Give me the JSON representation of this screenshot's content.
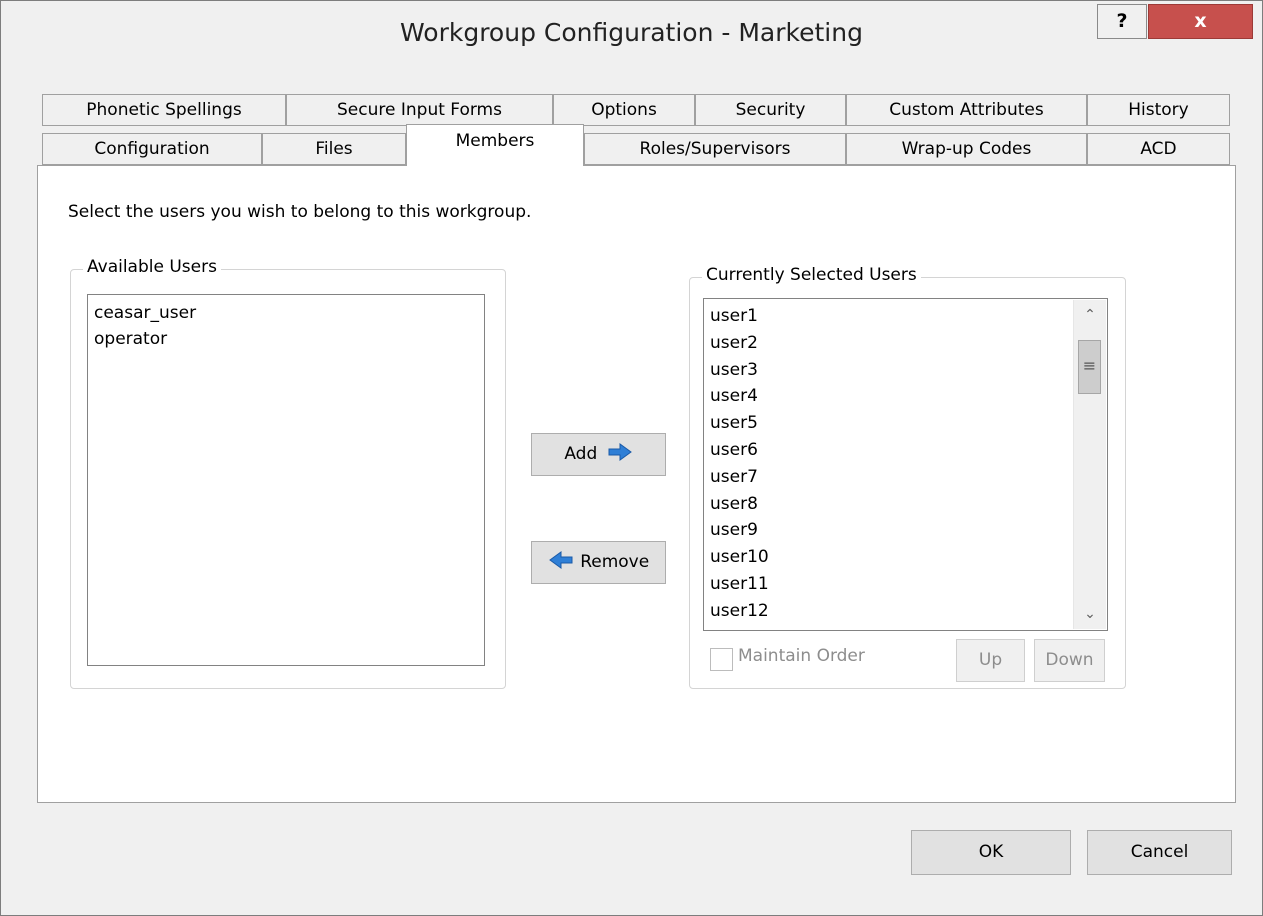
{
  "window": {
    "title": "Workgroup Configuration - Marketing",
    "help_label": "?",
    "close_label": "x"
  },
  "tabs": {
    "row1": [
      {
        "label": "Phonetic Spellings"
      },
      {
        "label": "Secure Input Forms"
      },
      {
        "label": "Options"
      },
      {
        "label": "Security"
      },
      {
        "label": "Custom Attributes"
      },
      {
        "label": "History"
      }
    ],
    "row2": [
      {
        "label": "Configuration"
      },
      {
        "label": "Files"
      },
      {
        "label": "Members",
        "active": true
      },
      {
        "label": "Roles/Supervisors"
      },
      {
        "label": "Wrap-up Codes"
      },
      {
        "label": "ACD"
      }
    ]
  },
  "members": {
    "instruction": "Select the users you wish to belong to this workgroup.",
    "available_group_label": "Available Users",
    "available_users": [
      "ceasar_user",
      "operator"
    ],
    "add_label": "Add",
    "remove_label": "Remove",
    "selected_group_label": "Currently Selected Users",
    "selected_users": [
      "user1",
      "user2",
      "user3",
      "user4",
      "user5",
      "user6",
      "user7",
      "user8",
      "user9",
      "user10",
      "user11",
      "user12"
    ],
    "maintain_order_label": "Maintain Order",
    "maintain_order_checked": false,
    "up_label": "Up",
    "down_label": "Down"
  },
  "footer": {
    "ok_label": "OK",
    "cancel_label": "Cancel"
  },
  "colors": {
    "close_button": "#c7504d",
    "arrow_blue": "#2f7fd6"
  }
}
